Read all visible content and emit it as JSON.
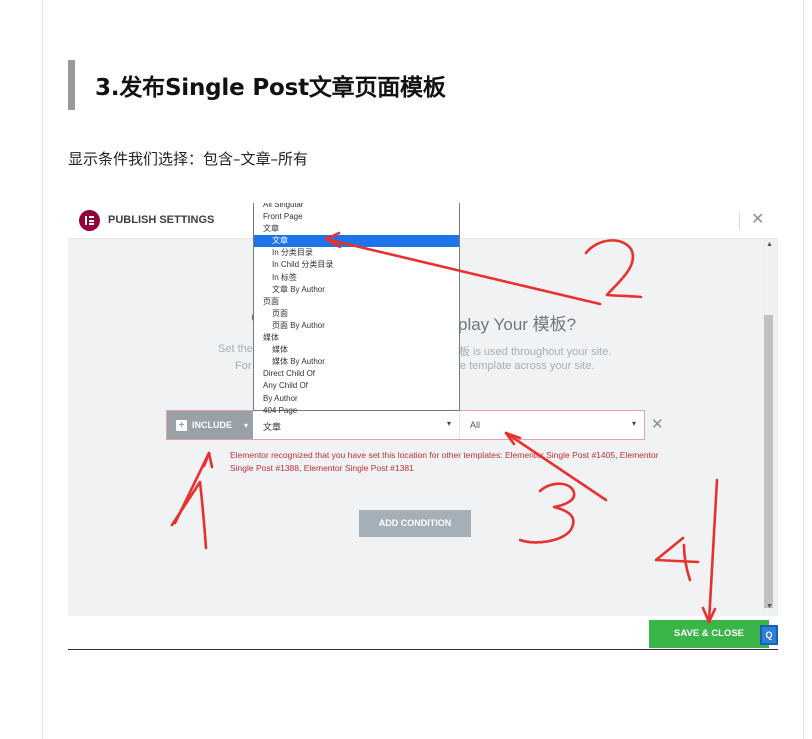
{
  "article": {
    "heading": "3.发布Single Post文章页面模板",
    "intro": "显示条件我们选择：包含–文章–所有"
  },
  "screenshot": {
    "header": {
      "title": "PUBLISH SETTINGS",
      "close": "✕"
    },
    "background_text": {
      "heading_left": "C",
      "heading_right": "play Your 模板?",
      "p1_left": "Set the",
      "p1_right": "板 is used throughout your site.",
      "p2_left": "For",
      "p2_right": "e template across your site."
    },
    "dropdown": {
      "items": [
        {
          "label": "All Singular",
          "sub": false
        },
        {
          "label": "Front Page",
          "sub": false
        },
        {
          "label": "文章",
          "sub": false
        },
        {
          "label": "文章",
          "sub": true,
          "selected": true
        },
        {
          "label": "In 分类目录",
          "sub": true
        },
        {
          "label": "In Child 分类目录",
          "sub": true
        },
        {
          "label": "In 标签",
          "sub": true
        },
        {
          "label": "文章 By Author",
          "sub": true
        },
        {
          "label": "页面",
          "sub": false
        },
        {
          "label": "页面",
          "sub": true
        },
        {
          "label": "页面 By Author",
          "sub": true
        },
        {
          "label": "媒体",
          "sub": false
        },
        {
          "label": "媒体",
          "sub": true
        },
        {
          "label": "媒体 By Author",
          "sub": true
        },
        {
          "label": "Direct Child Of",
          "sub": false
        },
        {
          "label": "Any Child Of",
          "sub": false
        },
        {
          "label": "By Author",
          "sub": false
        },
        {
          "label": "404 Page",
          "sub": false
        }
      ]
    },
    "condition": {
      "include_label": "INCLUDE",
      "include_plus": "+",
      "caret": "▾",
      "type_value": "文章",
      "scope_value": "All",
      "remove": "✕"
    },
    "warning": "Elementor recognized that you have set this location for other templates: Elementor Single Post #1405, Elementor Single Post #1388, Elementor Single Post #1381",
    "add_condition": "ADD CONDITION",
    "save_close": "SAVE & CLOSE",
    "q_button": "Q",
    "scroll_up": "▲",
    "scroll_down": "▼"
  },
  "annotations": {
    "color": "#e8312f",
    "numbers": [
      "1",
      "2",
      "3",
      "4"
    ]
  }
}
